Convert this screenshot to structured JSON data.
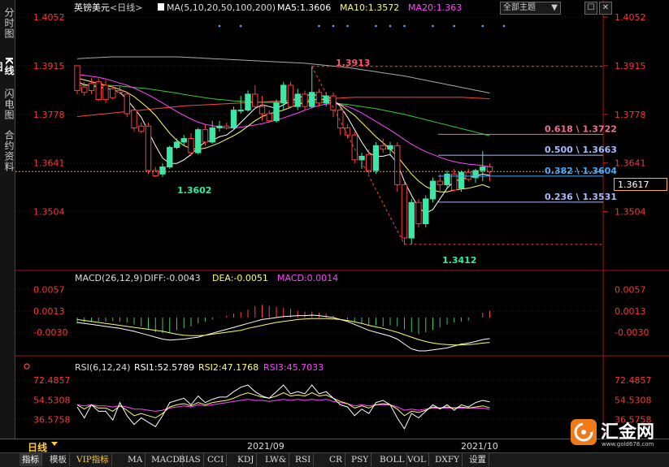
{
  "left_tabs": [
    "分时图",
    "K线图",
    "闪电图",
    "合约资料"
  ],
  "title": {
    "symbol": "英镑美元",
    "period": "<日线>",
    "ma_label": "MA(5,10,20,50,100,200)",
    "ma5": "MA5:1.3606",
    "ma10": "MA10:1.3572",
    "ma20": "MA20:1.363"
  },
  "theme_select": "全部主题",
  "theme_arrow": "▼",
  "window_buttons": [
    "☐",
    "✕"
  ],
  "colors": {
    "up": "#3ee6a6",
    "down": "#ff3a3a",
    "ma5": "#ffffff",
    "ma10": "#ffff66",
    "ma20": "#ff44ff",
    "ma50": "#33cc33",
    "ma100": "#ff4444",
    "ma200": "#aaaaaa",
    "grid": "#7a0000",
    "axis": "#cc2222"
  },
  "price_axis": [
    "1.4052",
    "1.3915",
    "1.3778",
    "1.3641",
    "1.3504"
  ],
  "current_price": "1.3617",
  "annotations": {
    "high": "1.3913",
    "low1": "1.3602",
    "low2": "1.3412"
  },
  "fib_levels": [
    {
      "label": "0.618 \\ 1.3722",
      "value": 1.3722,
      "color": "#ff6699"
    },
    {
      "label": "0.500 \\ 1.3663",
      "value": 1.3663,
      "color": "#aabbff"
    },
    {
      "label": "0.382 \\ 1.3604",
      "value": 1.3604,
      "color": "#44aaff"
    },
    {
      "label": "0.236 \\ 1.3531",
      "value": 1.3531,
      "color": "#aabbff"
    }
  ],
  "macd": {
    "label": "MACD(26,12,9)",
    "diff": "DIFF:-0.0043",
    "dea": "DEA:-0.0051",
    "macd": "MACD:0.0014",
    "axis": [
      "0.0057",
      "0.0013",
      "-0.0030"
    ]
  },
  "rsi": {
    "label": "RSI(6,12,24)",
    "rsi1": "RSI1:52.5789",
    "rsi2": "RSI2:47.1768",
    "rsi3": "RSI3:45.7033",
    "axis": [
      "72.4857",
      "54.5308",
      "36.5758"
    ]
  },
  "period_label": "日线",
  "dates": [
    "2021/09",
    "2021/10"
  ],
  "bottom_tabs": [
    "指标",
    "模板",
    "VIP指标",
    "MA",
    "MACD",
    "BIAS",
    "CCI",
    "KDJ",
    "LW&",
    "RSI",
    "CR",
    "PSY",
    "BOLL",
    "VOL",
    "DXFY",
    "设置"
  ],
  "watermark": {
    "text": "汇金网",
    "url": "www.gold678.com"
  },
  "chart_data": {
    "type": "candlestick",
    "title": "英镑美元 <日线>",
    "ylim": [
      1.335,
      1.4052
    ],
    "candles": [
      [
        1.3915,
        1.3905,
        1.3845,
        1.3835
      ],
      [
        1.3855,
        1.387,
        1.384,
        1.383
      ],
      [
        1.3865,
        1.388,
        1.3845,
        1.3835
      ],
      [
        1.387,
        1.388,
        1.382,
        1.3815
      ],
      [
        1.386,
        1.3875,
        1.382,
        1.381
      ],
      [
        1.385,
        1.386,
        1.3825,
        1.382
      ],
      [
        1.3845,
        1.386,
        1.384,
        1.3835
      ],
      [
        1.3835,
        1.384,
        1.378,
        1.377
      ],
      [
        1.379,
        1.38,
        1.374,
        1.373
      ],
      [
        1.3745,
        1.3755,
        1.373,
        1.3725
      ],
      [
        1.3745,
        1.3755,
        1.362,
        1.361
      ],
      [
        1.362,
        1.363,
        1.3605,
        1.3602
      ],
      [
        1.361,
        1.364,
        1.363,
        1.3602
      ],
      [
        1.363,
        1.369,
        1.3685,
        1.3625
      ],
      [
        1.3685,
        1.371,
        1.37,
        1.368
      ],
      [
        1.37,
        1.372,
        1.371,
        1.369
      ],
      [
        1.371,
        1.3725,
        1.367,
        1.366
      ],
      [
        1.367,
        1.374,
        1.3735,
        1.3665
      ],
      [
        1.3735,
        1.375,
        1.37,
        1.369
      ],
      [
        1.37,
        1.376,
        1.374,
        1.3695
      ],
      [
        1.374,
        1.376,
        1.3745,
        1.373
      ],
      [
        1.3745,
        1.3755,
        1.374,
        1.3735
      ],
      [
        1.374,
        1.38,
        1.379,
        1.3735
      ],
      [
        1.379,
        1.383,
        1.379,
        1.378
      ],
      [
        1.379,
        1.3845,
        1.3835,
        1.3785
      ],
      [
        1.3835,
        1.386,
        1.38,
        1.3795
      ],
      [
        1.38,
        1.383,
        1.378,
        1.376
      ],
      [
        1.378,
        1.379,
        1.376,
        1.3755
      ],
      [
        1.376,
        1.382,
        1.381,
        1.3755
      ],
      [
        1.381,
        1.387,
        1.386,
        1.379
      ],
      [
        1.386,
        1.387,
        1.38,
        1.3795
      ],
      [
        1.38,
        1.385,
        1.3835,
        1.379
      ],
      [
        1.3835,
        1.3845,
        1.38,
        1.379
      ],
      [
        1.38,
        1.3913,
        1.384,
        1.3795
      ],
      [
        1.384,
        1.385,
        1.381,
        1.38
      ],
      [
        1.381,
        1.384,
        1.383,
        1.38
      ],
      [
        1.383,
        1.384,
        1.379,
        1.377
      ],
      [
        1.379,
        1.38,
        1.374,
        1.372
      ],
      [
        1.374,
        1.375,
        1.372,
        1.371
      ],
      [
        1.372,
        1.373,
        1.365,
        1.364
      ],
      [
        1.365,
        1.367,
        1.366,
        1.3625
      ],
      [
        1.3665,
        1.368,
        1.362,
        1.361
      ],
      [
        1.362,
        1.37,
        1.369,
        1.361
      ],
      [
        1.369,
        1.371,
        1.368,
        1.367
      ],
      [
        1.368,
        1.37,
        1.369,
        1.366
      ],
      [
        1.369,
        1.37,
        1.358,
        1.356
      ],
      [
        1.358,
        1.359,
        1.343,
        1.3412
      ],
      [
        1.343,
        1.354,
        1.353,
        1.3412
      ],
      [
        1.353,
        1.354,
        1.347,
        1.346
      ],
      [
        1.347,
        1.355,
        1.354,
        1.346
      ],
      [
        1.354,
        1.36,
        1.359,
        1.353
      ],
      [
        1.359,
        1.361,
        1.358,
        1.356
      ],
      [
        1.358,
        1.362,
        1.361,
        1.357
      ],
      [
        1.361,
        1.3625,
        1.3565,
        1.356
      ],
      [
        1.357,
        1.362,
        1.3615,
        1.356
      ],
      [
        1.3615,
        1.3625,
        1.3595,
        1.359
      ],
      [
        1.36,
        1.3625,
        1.362,
        1.3585
      ],
      [
        1.362,
        1.3675,
        1.363,
        1.359
      ],
      [
        1.363,
        1.364,
        1.3617,
        1.359
      ]
    ],
    "ma5": [
      1.387,
      1.3862,
      1.3858,
      1.3855,
      1.3852,
      1.3848,
      1.384,
      1.382,
      1.3795,
      1.377,
      1.373,
      1.369,
      1.3655,
      1.364,
      1.364,
      1.365,
      1.3665,
      1.3685,
      1.37,
      1.3705,
      1.3715,
      1.372,
      1.3735,
      1.3755,
      1.3775,
      1.3795,
      1.3805,
      1.38,
      1.3795,
      1.3805,
      1.3815,
      1.3825,
      1.383,
      1.3835,
      1.383,
      1.383,
      1.382,
      1.38,
      1.377,
      1.3735,
      1.37,
      1.367,
      1.366,
      1.366,
      1.3665,
      1.364,
      1.359,
      1.355,
      1.3515,
      1.35,
      1.351,
      1.354,
      1.357,
      1.359,
      1.3595,
      1.36,
      1.3605,
      1.361,
      1.3606
    ],
    "ma10": [
      1.388,
      1.3875,
      1.387,
      1.3865,
      1.386,
      1.3855,
      1.3848,
      1.384,
      1.3828,
      1.3812,
      1.3795,
      1.3775,
      1.375,
      1.3725,
      1.3705,
      1.369,
      1.3682,
      1.368,
      1.3683,
      1.369,
      1.3698,
      1.3708,
      1.3718,
      1.373,
      1.3745,
      1.376,
      1.3772,
      1.378,
      1.3785,
      1.379,
      1.3798,
      1.3805,
      1.3812,
      1.3818,
      1.382,
      1.382,
      1.3815,
      1.3805,
      1.379,
      1.3775,
      1.3755,
      1.3735,
      1.3715,
      1.3698,
      1.368,
      1.366,
      1.3635,
      1.361,
      1.359,
      1.3575,
      1.3565,
      1.356,
      1.356,
      1.3565,
      1.3568,
      1.357,
      1.3575,
      1.358,
      1.3572
    ],
    "ma20": [
      1.389,
      1.3888,
      1.3885,
      1.3882,
      1.3878,
      1.3872,
      1.3866,
      1.386,
      1.3852,
      1.3843,
      1.3833,
      1.3822,
      1.381,
      1.3798,
      1.3786,
      1.3775,
      1.3765,
      1.3756,
      1.375,
      1.3746,
      1.3742,
      1.374,
      1.374,
      1.3742,
      1.3745,
      1.3748,
      1.3752,
      1.3757,
      1.3762,
      1.3768,
      1.3775,
      1.3782,
      1.379,
      1.3797,
      1.3803,
      1.3807,
      1.3808,
      1.3806,
      1.38,
      1.3792,
      1.3782,
      1.377,
      1.3758,
      1.3746,
      1.3734,
      1.3721,
      1.3707,
      1.3694,
      1.3683,
      1.3673,
      1.3665,
      1.3657,
      1.365,
      1.3645,
      1.3641,
      1.3638,
      1.3636,
      1.3634,
      1.363
    ],
    "ma50": [
      1.386,
      1.386,
      1.386,
      1.386,
      1.386,
      1.3859,
      1.3858,
      1.3856,
      1.3854,
      1.3852,
      1.385,
      1.3847,
      1.3844,
      1.3841,
      1.3838,
      1.3834,
      1.3831,
      1.3828,
      1.3825,
      1.3822,
      1.382,
      1.3818,
      1.3816,
      1.3815,
      1.3814,
      1.3813,
      1.3812,
      1.3812,
      1.3812,
      1.3812,
      1.3812,
      1.3812,
      1.3812,
      1.3812,
      1.3812,
      1.3811,
      1.381,
      1.3808,
      1.3806,
      1.3803,
      1.38,
      1.3797,
      1.3794,
      1.379,
      1.3786,
      1.3782,
      1.3778,
      1.3773,
      1.3768,
      1.3763,
      1.3758,
      1.3753,
      1.3748,
      1.3743,
      1.3738,
      1.3733,
      1.3728,
      1.3723,
      1.3718
    ],
    "ma100": [
      1.3772,
      1.3774,
      1.3776,
      1.3778,
      1.378,
      1.3782,
      1.3784,
      1.3786,
      1.3788,
      1.379,
      1.3792,
      1.3794,
      1.3796,
      1.3798,
      1.38,
      1.3802,
      1.3803,
      1.3804,
      1.3805,
      1.3806,
      1.3807,
      1.3808,
      1.3809,
      1.381,
      1.3811,
      1.3812,
      1.3813,
      1.3814,
      1.3815,
      1.3816,
      1.3817,
      1.3818,
      1.3819,
      1.382,
      1.3821,
      1.3822,
      1.3823,
      1.3824,
      1.3825,
      1.3826,
      1.3826,
      1.3826,
      1.3826,
      1.3826,
      1.3826,
      1.3826,
      1.3826,
      1.3826,
      1.3826,
      1.3826,
      1.3826,
      1.3826,
      1.3826,
      1.3826,
      1.3826,
      1.3825,
      1.3824,
      1.3823,
      1.3822
    ],
    "ma200": [
      1.3935,
      1.3936,
      1.3937,
      1.3938,
      1.3939,
      1.394,
      1.394,
      1.394,
      1.394,
      1.394,
      1.394,
      1.394,
      1.394,
      1.394,
      1.394,
      1.3939,
      1.3938,
      1.3937,
      1.3936,
      1.3935,
      1.3934,
      1.3933,
      1.3932,
      1.3931,
      1.393,
      1.3929,
      1.3928,
      1.3927,
      1.3926,
      1.3925,
      1.3924,
      1.3923,
      1.3922,
      1.392,
      1.3918,
      1.3916,
      1.3914,
      1.3912,
      1.391,
      1.3907,
      1.3904,
      1.3901,
      1.3898,
      1.3895,
      1.3892,
      1.3889,
      1.3886,
      1.3882,
      1.3878,
      1.3874,
      1.387,
      1.3866,
      1.3862,
      1.3858,
      1.3854,
      1.385,
      1.3846,
      1.3842,
      1.3838
    ],
    "macd_ylim": [
      -0.0068,
      0.0068
    ],
    "macd_hist": [
      -0.0012,
      -0.001,
      -0.0009,
      -0.0008,
      -0.0008,
      -0.0007,
      -0.0008,
      -0.001,
      -0.0014,
      -0.0018,
      -0.0024,
      -0.003,
      -0.0032,
      -0.003,
      -0.0026,
      -0.0022,
      -0.0018,
      -0.0012,
      -0.0008,
      -0.0004,
      0.0001,
      0.0004,
      0.0008,
      0.0011,
      0.0016,
      0.0023,
      0.0026,
      0.0024,
      0.0022,
      0.002,
      0.0018,
      0.0014,
      0.0012,
      0.0012,
      0.001,
      0.0008,
      0.0004,
      0.0001,
      -0.0004,
      -0.0008,
      -0.0012,
      -0.0015,
      -0.0016,
      -0.0018,
      -0.0016,
      -0.0018,
      -0.0024,
      -0.003,
      -0.0034,
      -0.003,
      -0.0026,
      -0.002,
      -0.0014,
      -0.001,
      -0.0008,
      -0.0006,
      0.0,
      0.001,
      0.0014
    ],
    "macd_diff": [
      -0.001,
      -0.0012,
      -0.0014,
      -0.0016,
      -0.0018,
      -0.002,
      -0.0022,
      -0.0025,
      -0.0028,
      -0.0032,
      -0.0036,
      -0.004,
      -0.0044,
      -0.0046,
      -0.0045,
      -0.0044,
      -0.0042,
      -0.004,
      -0.0036,
      -0.0032,
      -0.0028,
      -0.0024,
      -0.002,
      -0.0016,
      -0.0012,
      -0.0008,
      -0.0004,
      -0.0002,
      0.0,
      0.0002,
      0.0003,
      0.0004,
      0.0004,
      0.0005,
      0.0004,
      0.0002,
      0.0,
      -0.0004,
      -0.0008,
      -0.0014,
      -0.002,
      -0.0026,
      -0.003,
      -0.0034,
      -0.0038,
      -0.0044,
      -0.0054,
      -0.0064,
      -0.0068,
      -0.0068,
      -0.0066,
      -0.0064,
      -0.0062,
      -0.0058,
      -0.0054,
      -0.0052,
      -0.0049,
      -0.0045,
      -0.0043
    ],
    "macd_dea": [
      -0.0004,
      -0.0006,
      -0.0008,
      -0.001,
      -0.0012,
      -0.0014,
      -0.0016,
      -0.0018,
      -0.002,
      -0.0022,
      -0.0024,
      -0.0026,
      -0.0028,
      -0.0031,
      -0.0034,
      -0.0036,
      -0.0037,
      -0.0037,
      -0.0036,
      -0.0034,
      -0.0032,
      -0.003,
      -0.0028,
      -0.0026,
      -0.0022,
      -0.0019,
      -0.0016,
      -0.0013,
      -0.001,
      -0.0008,
      -0.0006,
      -0.0004,
      -0.0003,
      -0.0002,
      -0.0002,
      -0.0002,
      -0.0003,
      -0.0004,
      -0.0006,
      -0.0009,
      -0.0012,
      -0.0016,
      -0.0019,
      -0.0022,
      -0.0026,
      -0.003,
      -0.0035,
      -0.004,
      -0.0045,
      -0.0049,
      -0.0052,
      -0.0054,
      -0.0055,
      -0.0056,
      -0.0056,
      -0.0055,
      -0.0054,
      -0.0052,
      -0.0051
    ],
    "rsi_ylim": [
      25,
      80
    ],
    "rsi1": [
      48,
      38,
      50,
      44,
      44,
      36,
      52,
      40,
      32,
      38,
      34,
      30,
      40,
      52,
      54,
      56,
      50,
      58,
      52,
      55,
      57,
      57,
      62,
      66,
      68,
      62,
      58,
      56,
      62,
      68,
      60,
      62,
      60,
      68,
      60,
      62,
      56,
      50,
      48,
      40,
      46,
      42,
      52,
      54,
      50,
      38,
      28,
      42,
      38,
      44,
      50,
      46,
      50,
      45,
      50,
      48,
      52,
      54,
      52.58
    ],
    "rsi2": [
      50,
      46,
      50,
      47,
      47,
      44,
      49,
      45,
      40,
      42,
      40,
      38,
      42,
      48,
      50,
      51,
      49,
      52,
      50,
      52,
      53,
      54,
      56,
      59,
      61,
      59,
      57,
      56,
      58,
      61,
      58,
      59,
      58,
      61,
      58,
      59,
      56,
      53,
      51,
      47,
      49,
      47,
      50,
      51,
      50,
      46,
      40,
      44,
      43,
      45,
      48,
      47,
      48,
      47,
      48,
      47,
      48,
      49,
      47.18
    ],
    "rsi3": [
      50,
      49,
      50,
      49,
      49,
      48,
      49,
      48,
      46,
      46,
      45,
      44,
      45,
      47,
      48,
      49,
      48,
      50,
      49,
      50,
      51,
      52,
      53,
      54,
      55,
      54,
      54,
      53,
      54,
      55,
      54,
      55,
      54,
      55,
      54,
      55,
      53,
      52,
      51,
      49,
      50,
      49,
      50,
      50,
      50,
      48,
      45,
      46,
      45,
      46,
      47,
      47,
      47,
      47,
      47,
      47,
      47,
      47,
      45.7
    ]
  }
}
